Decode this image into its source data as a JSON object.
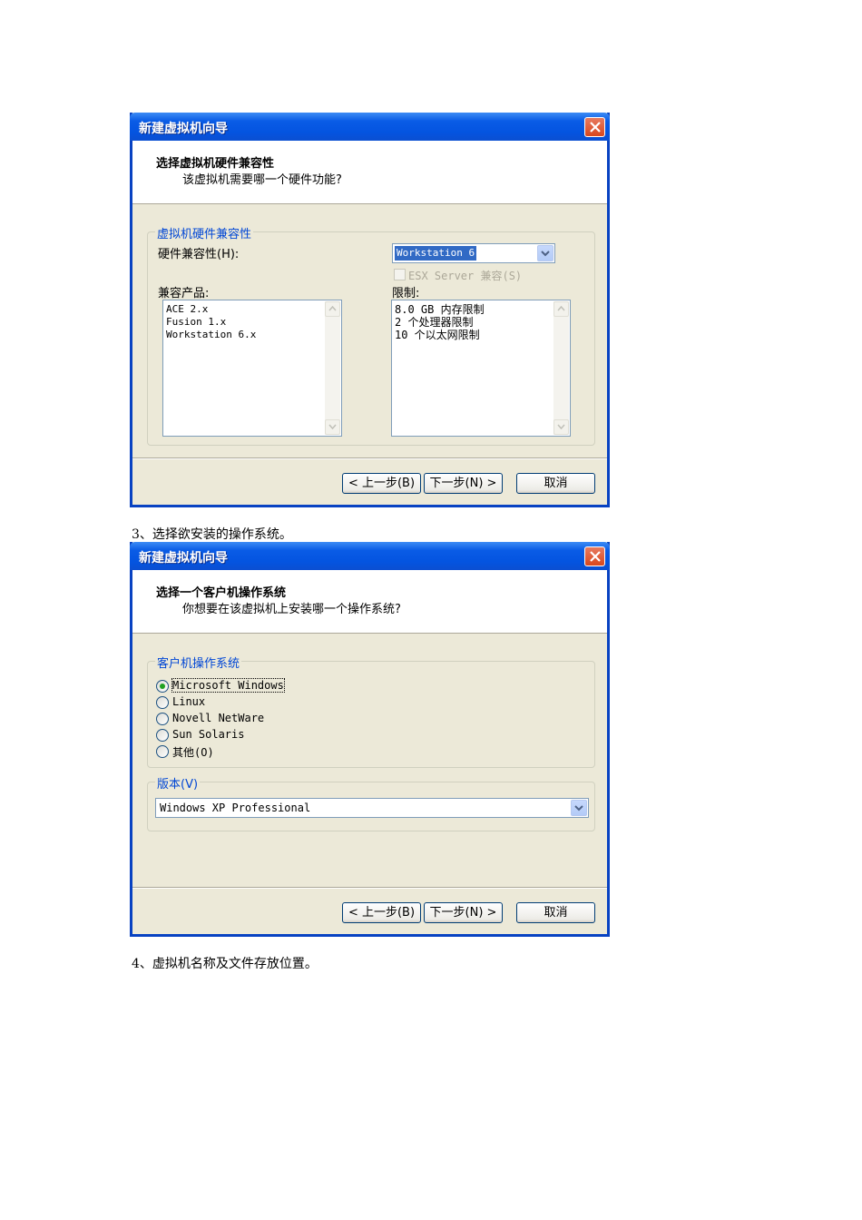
{
  "dialog1": {
    "title": "新建虚拟机向导",
    "header_title": "选择虚拟机硬件兼容性",
    "header_subtitle": "该虚拟机需要哪一个硬件功能?",
    "group_label": "虚拟机硬件兼容性",
    "hw_compat_label": "硬件兼容性(H):",
    "hw_compat_value": "Workstation 6",
    "esx_checkbox_label": "ESX Server 兼容(S)",
    "compatible_products_label": "兼容产品:",
    "compatible_products": [
      "ACE 2.x",
      "Fusion 1.x",
      "Workstation 6.x"
    ],
    "limits_label": "限制:",
    "limits": [
      "8.0 GB 内存限制",
      "2 个处理器限制",
      "10 个以太网限制"
    ],
    "back_button": "< 上一步(B)",
    "next_button": "下一步(N) >",
    "cancel_button": "取消"
  },
  "caption1": "3、选择欲安装的操作系统。",
  "dialog2": {
    "title": "新建虚拟机向导",
    "header_title": "选择一个客户机操作系统",
    "header_subtitle": "你想要在该虚拟机上安装哪一个操作系统?",
    "group_label": "客户机操作系统",
    "os_options": [
      "Microsoft Windows",
      "Linux",
      "Novell NetWare",
      "Sun Solaris",
      "其他(O)"
    ],
    "selected_os": "Microsoft Windows",
    "version_group_label": "版本(V)",
    "version_value": "Windows XP Professional",
    "back_button": "< 上一步(B)",
    "next_button": "下一步(N) >",
    "cancel_button": "取消"
  },
  "caption2": "4、虚拟机名称及文件存放位置。"
}
